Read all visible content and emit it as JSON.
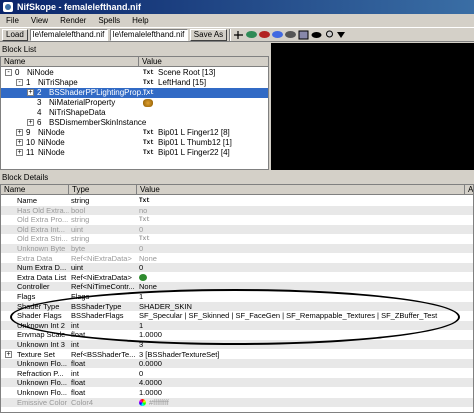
{
  "window": {
    "title": "NifSkope - femalelefthand.nif"
  },
  "menu": [
    "File",
    "View",
    "Render",
    "Spells",
    "Help"
  ],
  "toolbar": {
    "load_label": "Load",
    "load_path": "le\\femalelefthand.nif",
    "save_path": "le\\femalelefthand.nif",
    "saveas_label": "Save As"
  },
  "blocklist": {
    "title": "Block List",
    "col_name": "Name",
    "col_value": "Value",
    "rows": [
      {
        "indent": 0,
        "exp": "-",
        "num": "0",
        "name": "NiNode",
        "tag": "Txt",
        "value": "Scene Root [13]",
        "sel": false
      },
      {
        "indent": 1,
        "exp": "-",
        "num": "1",
        "name": "NiTriShape",
        "tag": "Txt",
        "value": "LeftHand [15]",
        "sel": false
      },
      {
        "indent": 2,
        "exp": "+",
        "num": "2",
        "name": "BSShaderPPLightingProp...",
        "tag": "Txt",
        "value": "",
        "sel": true
      },
      {
        "indent": 2,
        "exp": "",
        "num": "3",
        "name": "NiMaterialProperty",
        "tag": "icon",
        "value": "",
        "sel": false
      },
      {
        "indent": 2,
        "exp": "",
        "num": "4",
        "name": "NiTriShapeData",
        "tag": "",
        "value": "",
        "sel": false
      },
      {
        "indent": 2,
        "exp": "+",
        "num": "6",
        "name": "BSDismemberSkinInstance",
        "tag": "",
        "value": "",
        "sel": false
      },
      {
        "indent": 1,
        "exp": "+",
        "num": "9",
        "name": "NiNode",
        "tag": "Txt",
        "value": "Bip01 L Finger12 [8]",
        "sel": false
      },
      {
        "indent": 1,
        "exp": "+",
        "num": "10",
        "name": "NiNode",
        "tag": "Txt",
        "value": "Bip01 L Thumb12 [1]",
        "sel": false
      },
      {
        "indent": 1,
        "exp": "+",
        "num": "11",
        "name": "NiNode",
        "tag": "Txt",
        "value": "Bip01 L Finger22 [4]",
        "sel": false
      }
    ]
  },
  "details": {
    "title": "Block Details",
    "col_name": "Name",
    "col_type": "Type",
    "col_value": "Value",
    "col_arg": "Ar",
    "rows": [
      {
        "name": "Name",
        "type": "string",
        "value": "Txt",
        "gray": false,
        "exp": "",
        "icon": ""
      },
      {
        "name": "Has Old Extra...",
        "type": "bool",
        "value": "no",
        "gray": true,
        "exp": "",
        "icon": ""
      },
      {
        "name": "Old Extra Pro...",
        "type": "string",
        "value": "Txt",
        "gray": true,
        "exp": "",
        "icon": ""
      },
      {
        "name": "Old Extra Int...",
        "type": "uint",
        "value": "0",
        "gray": true,
        "exp": "",
        "icon": ""
      },
      {
        "name": "Old Extra Stri...",
        "type": "string",
        "value": "Txt",
        "gray": true,
        "exp": "",
        "icon": ""
      },
      {
        "name": "Unknown Byte",
        "type": "byte",
        "value": "0",
        "gray": true,
        "exp": "",
        "icon": ""
      },
      {
        "name": "Extra Data",
        "type": "Ref<NiExtraData>",
        "value": "None",
        "gray": true,
        "exp": "",
        "icon": ""
      },
      {
        "name": "Num Extra D...",
        "type": "uint",
        "value": "0",
        "gray": false,
        "exp": "",
        "icon": ""
      },
      {
        "name": "Extra Data List",
        "type": "Ref<NiExtraData>",
        "value": "",
        "gray": false,
        "exp": "",
        "icon": "green"
      },
      {
        "name": "Controller",
        "type": "Ref<NiTimeContr...",
        "value": "None",
        "gray": false,
        "exp": "",
        "icon": ""
      },
      {
        "name": "Flags",
        "type": "Flags",
        "value": "1",
        "gray": false,
        "exp": "",
        "icon": ""
      },
      {
        "name": "Shader Type",
        "type": "BSShaderType",
        "value": "SHADER_SKIN",
        "gray": false,
        "exp": "",
        "icon": ""
      },
      {
        "name": "Shader Flags",
        "type": "BSShaderFlags",
        "value": "SF_Specular | SF_Skinned | SF_FaceGen | SF_Remappable_Textures | SF_ZBuffer_Test",
        "gray": false,
        "exp": "",
        "icon": ""
      },
      {
        "name": "Unknown Int 2",
        "type": "int",
        "value": "1",
        "gray": false,
        "exp": "",
        "icon": ""
      },
      {
        "name": "Envmap Scale",
        "type": "float",
        "value": "1.0000",
        "gray": false,
        "exp": "",
        "icon": ""
      },
      {
        "name": "Unknown Int 3",
        "type": "int",
        "value": "3",
        "gray": false,
        "exp": "",
        "icon": ""
      },
      {
        "name": "Texture Set",
        "type": "Ref<BSShaderTe...",
        "value": "3 [BSShaderTextureSet]",
        "gray": false,
        "exp": "+",
        "icon": ""
      },
      {
        "name": "Unknown Flo...",
        "type": "float",
        "value": "0.0000",
        "gray": false,
        "exp": "",
        "icon": ""
      },
      {
        "name": "Refraction P...",
        "type": "int",
        "value": "0",
        "gray": false,
        "exp": "",
        "icon": ""
      },
      {
        "name": "Unknown Flo...",
        "type": "float",
        "value": "4.0000",
        "gray": false,
        "exp": "",
        "icon": ""
      },
      {
        "name": "Unknown Flo...",
        "type": "float",
        "value": "1.0000",
        "gray": false,
        "exp": "",
        "icon": ""
      },
      {
        "name": "Emissive Color",
        "type": "Color4",
        "value": "#ffffffff",
        "gray": true,
        "exp": "",
        "icon": "wheel"
      }
    ]
  },
  "colors": {
    "selection": "#316ac5",
    "title_start": "#0a246a",
    "title_end": "#3a6ea5"
  }
}
